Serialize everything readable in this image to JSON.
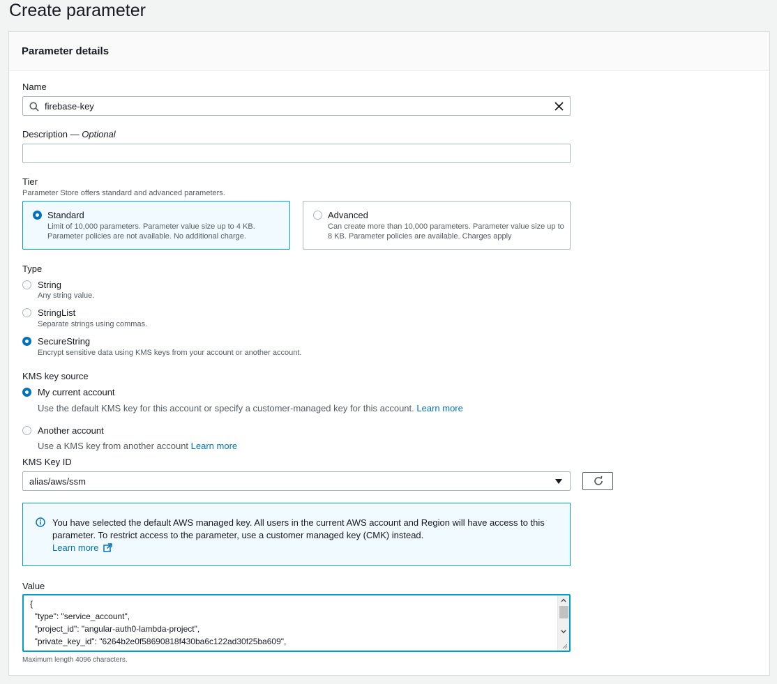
{
  "page": {
    "title": "Create parameter"
  },
  "panel": {
    "title": "Parameter details"
  },
  "name": {
    "label": "Name",
    "value": "firebase-key"
  },
  "description": {
    "label": "Description — ",
    "optional": "Optional",
    "value": ""
  },
  "tier": {
    "label": "Tier",
    "hint": "Parameter Store offers standard and advanced parameters.",
    "options": [
      {
        "title": "Standard",
        "desc": "Limit of 10,000 parameters. Parameter value size up to 4 KB. Parameter policies are not available. No additional charge.",
        "selected": true
      },
      {
        "title": "Advanced",
        "desc": "Can create more than 10,000 parameters. Parameter value size up to 8 KB. Parameter policies are available. Charges apply",
        "selected": false
      }
    ]
  },
  "type": {
    "label": "Type",
    "options": [
      {
        "title": "String",
        "desc": "Any string value.",
        "selected": false
      },
      {
        "title": "StringList",
        "desc": "Separate strings using commas.",
        "selected": false
      },
      {
        "title": "SecureString",
        "desc": "Encrypt sensitive data using KMS keys from your account or another account.",
        "selected": true
      }
    ]
  },
  "kms_source": {
    "label": "KMS key source",
    "options": [
      {
        "title": "My current account",
        "desc": "Use the default KMS key for this account or specify a customer-managed key for this account. ",
        "link": "Learn more",
        "selected": true
      },
      {
        "title": "Another account",
        "desc": "Use a KMS key from another account ",
        "link": "Learn more",
        "selected": false
      }
    ]
  },
  "kms_key_id": {
    "label": "KMS Key ID",
    "value": "alias/aws/ssm"
  },
  "info": {
    "text": "You have selected the default AWS managed key. All users in the current AWS account and Region will have access to this parameter. To restrict access to the parameter, use a customer managed key (CMK) instead.",
    "link": "Learn more"
  },
  "value": {
    "label": "Value",
    "lines": [
      "{",
      "  \"type\": \"service_account\",",
      "  \"project_id\": \"angular-auth0-lambda-project\",",
      "  \"private_key_id\": \"6264b2e0f58690818f430ba6c122ad30f25ba609\","
    ],
    "hint": "Maximum length 4096 characters."
  },
  "colors": {
    "accent": "#0073bb",
    "selected_border": "#00a1c9",
    "selected_bg": "#f1faff"
  }
}
